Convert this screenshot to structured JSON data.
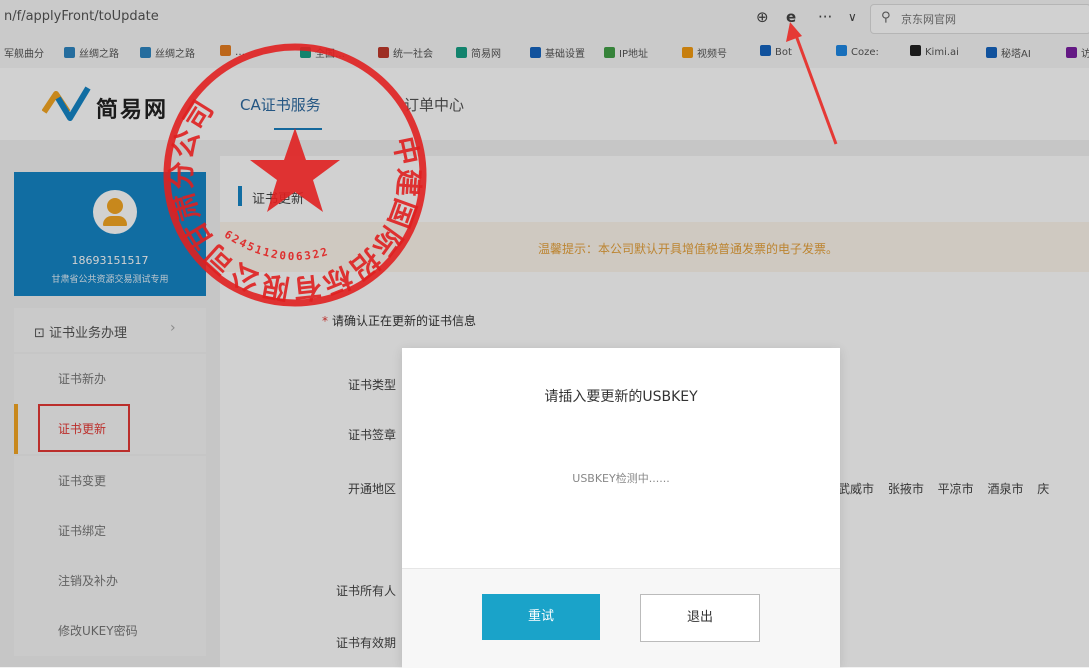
{
  "browser": {
    "url": "n/f/applyFront/toUpdate",
    "search_placeholder": "京东网官网",
    "bookmarks": [
      "军舰曲分",
      "丝绸之路",
      "丝绸之路",
      "…",
      "全国…",
      "统一社会",
      "简易网",
      "基础设置",
      "IP地址",
      "视频号",
      "Bot",
      "Coze:",
      "Kimi.ai",
      "秘塔AI",
      "访"
    ],
    "bookmark_colors": [
      "#c0392b",
      "#2e86c1",
      "#2e86c1",
      "#e67e22",
      "#16a085",
      "#c0392b",
      "#16a085",
      "#1565c0",
      "#43a047",
      "#f39c12",
      "#1565c0",
      "#1e88e5",
      "#222222",
      "#1565c0",
      "#7b1fa2"
    ]
  },
  "site": {
    "logo_text": "简易网",
    "nav_cert": "CA证书服务",
    "nav_order": "订单中心",
    "accent": "#1585c6"
  },
  "sidebar": {
    "phone": "18693151517",
    "org": "甘肃省公共资源交易测试专用",
    "menu_header": "证书业务办理",
    "items": [
      {
        "label": "证书新办"
      },
      {
        "label": "证书更新"
      },
      {
        "label": "证书变更"
      },
      {
        "label": "证书绑定"
      },
      {
        "label": "注销及补办"
      },
      {
        "label": "修改UKEY密码"
      }
    ]
  },
  "main": {
    "section_title": "证书更新",
    "tip": "温馨提示：本公司默认开具增值税普通发票的电子发票。",
    "confirm": "请确认正在更新的证书信息",
    "confirm_mark": "*",
    "rows": [
      "证书类型",
      "证书签章",
      "开通地区",
      "证书所有人",
      "证书有效期"
    ],
    "cities": "武威市 张掖市 平凉市 酒泉市 庆"
  },
  "dialog": {
    "title": "请插入要更新的USBKEY",
    "message": "USBKEY检测中......",
    "retry": "重试",
    "exit": "退出"
  },
  "stamp": {
    "text": "中建国际招标有限公司甘肃分公司",
    "number": "6245112006322",
    "color": "#e02020"
  }
}
